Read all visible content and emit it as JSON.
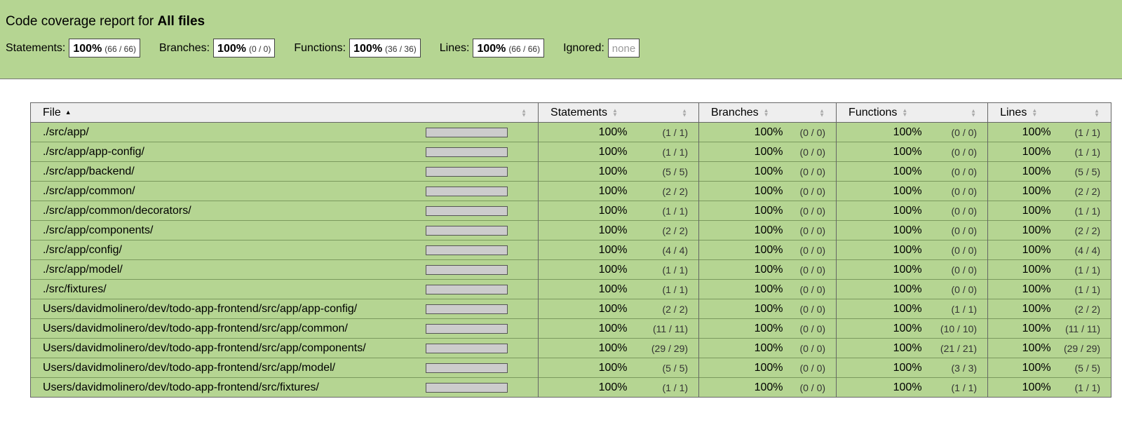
{
  "header": {
    "title_prefix": "Code coverage report for ",
    "title_target": "All files",
    "metrics": [
      {
        "label": "Statements:",
        "pct": "100%",
        "frac": "(66 / 66)"
      },
      {
        "label": "Branches:",
        "pct": "100%",
        "frac": "(0 / 0)"
      },
      {
        "label": "Functions:",
        "pct": "100%",
        "frac": "(36 / 36)"
      },
      {
        "label": "Lines:",
        "pct": "100%",
        "frac": "(66 / 66)"
      }
    ],
    "ignored": {
      "label": "Ignored:",
      "value": "none"
    }
  },
  "table": {
    "headers": {
      "file": "File",
      "statements": "Statements",
      "branches": "Branches",
      "functions": "Functions",
      "lines": "Lines"
    },
    "colors": {
      "high": "#b5d592",
      "header_bg": "#eeeeee",
      "bar_empty": "#cccccc"
    },
    "rows": [
      {
        "file": "./src/app/",
        "coverage_fraction": 1.0,
        "s_pct": "100%",
        "s_abs": "(1 / 1)",
        "b_pct": "100%",
        "b_abs": "(0 / 0)",
        "f_pct": "100%",
        "f_abs": "(0 / 0)",
        "l_pct": "100%",
        "l_abs": "(1 / 1)"
      },
      {
        "file": "./src/app/app-config/",
        "coverage_fraction": 1.0,
        "s_pct": "100%",
        "s_abs": "(1 / 1)",
        "b_pct": "100%",
        "b_abs": "(0 / 0)",
        "f_pct": "100%",
        "f_abs": "(0 / 0)",
        "l_pct": "100%",
        "l_abs": "(1 / 1)"
      },
      {
        "file": "./src/app/backend/",
        "coverage_fraction": 1.0,
        "s_pct": "100%",
        "s_abs": "(5 / 5)",
        "b_pct": "100%",
        "b_abs": "(0 / 0)",
        "f_pct": "100%",
        "f_abs": "(0 / 0)",
        "l_pct": "100%",
        "l_abs": "(5 / 5)"
      },
      {
        "file": "./src/app/common/",
        "coverage_fraction": 1.0,
        "s_pct": "100%",
        "s_abs": "(2 / 2)",
        "b_pct": "100%",
        "b_abs": "(0 / 0)",
        "f_pct": "100%",
        "f_abs": "(0 / 0)",
        "l_pct": "100%",
        "l_abs": "(2 / 2)"
      },
      {
        "file": "./src/app/common/decorators/",
        "coverage_fraction": 1.0,
        "s_pct": "100%",
        "s_abs": "(1 / 1)",
        "b_pct": "100%",
        "b_abs": "(0 / 0)",
        "f_pct": "100%",
        "f_abs": "(0 / 0)",
        "l_pct": "100%",
        "l_abs": "(1 / 1)"
      },
      {
        "file": "./src/app/components/",
        "coverage_fraction": 1.0,
        "s_pct": "100%",
        "s_abs": "(2 / 2)",
        "b_pct": "100%",
        "b_abs": "(0 / 0)",
        "f_pct": "100%",
        "f_abs": "(0 / 0)",
        "l_pct": "100%",
        "l_abs": "(2 / 2)"
      },
      {
        "file": "./src/app/config/",
        "coverage_fraction": 1.0,
        "s_pct": "100%",
        "s_abs": "(4 / 4)",
        "b_pct": "100%",
        "b_abs": "(0 / 0)",
        "f_pct": "100%",
        "f_abs": "(0 / 0)",
        "l_pct": "100%",
        "l_abs": "(4 / 4)"
      },
      {
        "file": "./src/app/model/",
        "coverage_fraction": 1.0,
        "s_pct": "100%",
        "s_abs": "(1 / 1)",
        "b_pct": "100%",
        "b_abs": "(0 / 0)",
        "f_pct": "100%",
        "f_abs": "(0 / 0)",
        "l_pct": "100%",
        "l_abs": "(1 / 1)"
      },
      {
        "file": "./src/fixtures/",
        "coverage_fraction": 1.0,
        "s_pct": "100%",
        "s_abs": "(1 / 1)",
        "b_pct": "100%",
        "b_abs": "(0 / 0)",
        "f_pct": "100%",
        "f_abs": "(0 / 0)",
        "l_pct": "100%",
        "l_abs": "(1 / 1)"
      },
      {
        "file": "Users/davidmolinero/dev/todo-app-frontend/src/app/app-config/",
        "coverage_fraction": 1.0,
        "s_pct": "100%",
        "s_abs": "(2 / 2)",
        "b_pct": "100%",
        "b_abs": "(0 / 0)",
        "f_pct": "100%",
        "f_abs": "(1 / 1)",
        "l_pct": "100%",
        "l_abs": "(2 / 2)"
      },
      {
        "file": "Users/davidmolinero/dev/todo-app-frontend/src/app/common/",
        "coverage_fraction": 1.0,
        "s_pct": "100%",
        "s_abs": "(11 / 11)",
        "b_pct": "100%",
        "b_abs": "(0 / 0)",
        "f_pct": "100%",
        "f_abs": "(10 / 10)",
        "l_pct": "100%",
        "l_abs": "(11 / 11)"
      },
      {
        "file": "Users/davidmolinero/dev/todo-app-frontend/src/app/components/",
        "coverage_fraction": 1.0,
        "s_pct": "100%",
        "s_abs": "(29 / 29)",
        "b_pct": "100%",
        "b_abs": "(0 / 0)",
        "f_pct": "100%",
        "f_abs": "(21 / 21)",
        "l_pct": "100%",
        "l_abs": "(29 / 29)"
      },
      {
        "file": "Users/davidmolinero/dev/todo-app-frontend/src/app/model/",
        "coverage_fraction": 1.0,
        "s_pct": "100%",
        "s_abs": "(5 / 5)",
        "b_pct": "100%",
        "b_abs": "(0 / 0)",
        "f_pct": "100%",
        "f_abs": "(3 / 3)",
        "l_pct": "100%",
        "l_abs": "(5 / 5)"
      },
      {
        "file": "Users/davidmolinero/dev/todo-app-frontend/src/fixtures/",
        "coverage_fraction": 1.0,
        "s_pct": "100%",
        "s_abs": "(1 / 1)",
        "b_pct": "100%",
        "b_abs": "(0 / 0)",
        "f_pct": "100%",
        "f_abs": "(1 / 1)",
        "l_pct": "100%",
        "l_abs": "(1 / 1)"
      }
    ]
  }
}
